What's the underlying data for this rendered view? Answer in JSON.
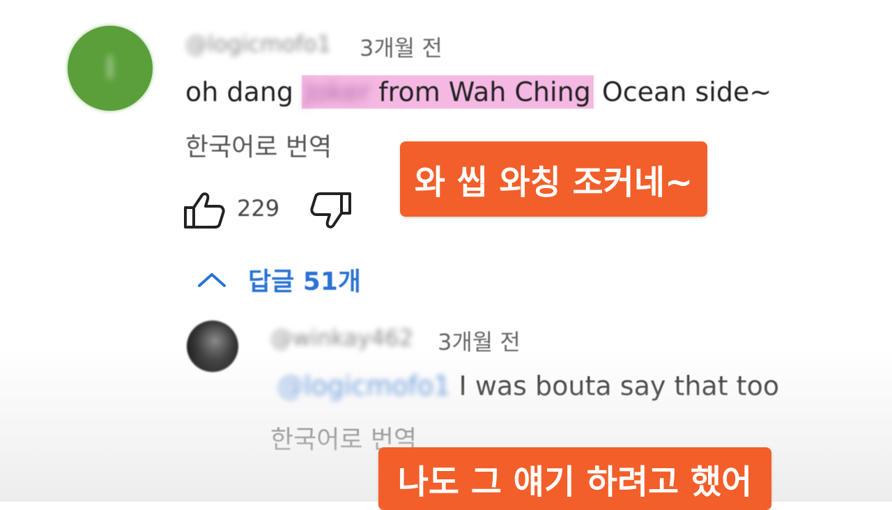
{
  "comment": {
    "author": "@logicmofo1",
    "time": "3개월 전",
    "text_before": "oh dang ",
    "text_blurred": "Joker",
    "text_highlight": " from Wah Ching",
    "text_after": " Ocean side~",
    "translate_label": "한국어로 번역",
    "like_count": "229",
    "avatar_initial": "l"
  },
  "captions": {
    "first": "와 씹 와칭 조커네~",
    "second": "나도 그 얘기 하려고 했어"
  },
  "replies": {
    "label_prefix": "답글 ",
    "count": "51",
    "label_suffix": "개"
  },
  "reply": {
    "author": "@winkay462",
    "time": "3개월 전",
    "mention": "@logicmofo1",
    "text": " I was bouta say that too",
    "translate_label": "한국어로 번역"
  },
  "colors": {
    "caption_bg": "#f25f2a",
    "highlight": "#f5b8e3",
    "link_blue": "#2a73d6",
    "avatar_green": "#5a9f3a"
  },
  "icons": {
    "like": "thumbs-up-icon",
    "dislike": "thumbs-down-icon",
    "collapse": "chevron-up-icon"
  }
}
